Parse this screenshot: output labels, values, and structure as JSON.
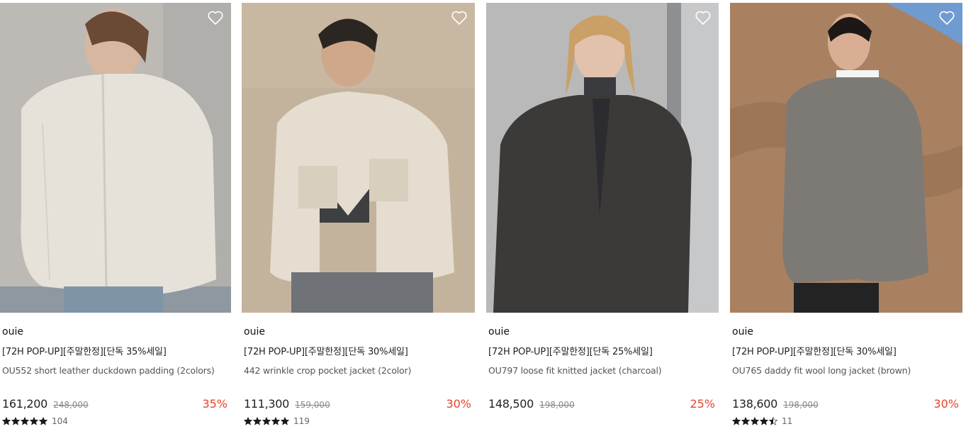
{
  "products": [
    {
      "brand": "ouie",
      "promo": "[72H POP-UP][주말한정][단독 35%세일]",
      "name": "OU552 short leather duckdown padding (2colors)",
      "price": "161,200",
      "original_price": "248,000",
      "discount": "35%",
      "review_count": "104",
      "rating_stars": 5,
      "photo_bg": "#bdbab6",
      "garment_color": "#e6e2da"
    },
    {
      "brand": "ouie",
      "promo": "[72H POP-UP][주말한정][단독 30%세일]",
      "name": "442 wrinkle crop pocket jacket (2color)",
      "price": "111,300",
      "original_price": "159,000",
      "discount": "30%",
      "review_count": "119",
      "rating_stars": 5,
      "photo_bg": "#c4b39c",
      "garment_color": "#e4ddd0"
    },
    {
      "brand": "ouie",
      "promo": "[72H POP-UP][주말한정][단독 25%세일]",
      "name": "OU797 loose fit knitted jacket (charcoal)",
      "price": "148,500",
      "original_price": "198,000",
      "discount": "25%",
      "review_count": "",
      "rating_stars": 0,
      "photo_bg": "#b9b9b9",
      "garment_color": "#3c3a39"
    },
    {
      "brand": "ouie",
      "promo": "[72H POP-UP][주말한정][단독 30%세일]",
      "name": "OU765 daddy fit wool long jacket (brown)",
      "price": "138,600",
      "original_price": "198,000",
      "discount": "30%",
      "review_count": "11",
      "rating_stars": 4.5,
      "photo_bg": "#b08a68",
      "garment_color": "#7d7a76"
    }
  ],
  "colors": {
    "discount": "#e8432b",
    "star": "#1a1a1a",
    "wish_icon": "#ffffff"
  }
}
